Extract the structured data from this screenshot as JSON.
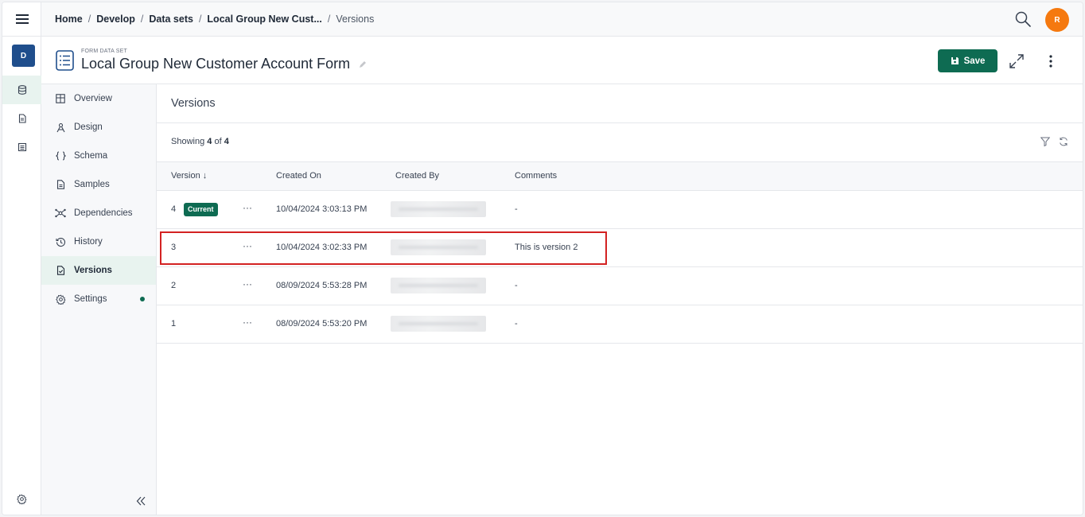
{
  "rail": {
    "workspace_letter": "D"
  },
  "breadcrumbs": [
    "Home",
    "Develop",
    "Data sets",
    "Local Group New Cust..."
  ],
  "breadcrumb_current": "Versions",
  "user": {
    "avatar_letter": "R",
    "avatar_color": "#f5790f"
  },
  "header": {
    "subtitle": "FORM DATA SET",
    "title": "Local Group New Customer Account Form",
    "save_label": "Save"
  },
  "sidenav": {
    "items": [
      {
        "label": "Overview",
        "icon": "table-icon"
      },
      {
        "label": "Design",
        "icon": "design-icon"
      },
      {
        "label": "Schema",
        "icon": "braces-icon"
      },
      {
        "label": "Samples",
        "icon": "file-icon"
      },
      {
        "label": "Dependencies",
        "icon": "network-icon"
      },
      {
        "label": "History",
        "icon": "history-icon"
      },
      {
        "label": "Versions",
        "icon": "versions-icon",
        "active": true
      },
      {
        "label": "Settings",
        "icon": "gear-icon",
        "dot": true
      }
    ]
  },
  "content": {
    "title": "Versions",
    "showing_prefix": "Showing",
    "showing_count": "4",
    "showing_of": "of",
    "showing_total": "4"
  },
  "table": {
    "columns": [
      "Version ↓",
      "Created On",
      "Created By",
      "Comments"
    ],
    "rows": [
      {
        "version": "4",
        "badge": "Current",
        "created_on": "10/04/2024 3:03:13 PM",
        "comments": "-"
      },
      {
        "version": "3",
        "badge": "",
        "created_on": "10/04/2024 3:02:33 PM",
        "comments": "This is version 2"
      },
      {
        "version": "2",
        "badge": "",
        "created_on": "08/09/2024 5:53:28 PM",
        "comments": "-"
      },
      {
        "version": "1",
        "badge": "",
        "created_on": "08/09/2024 5:53:20 PM",
        "comments": "-"
      }
    ]
  },
  "colors": {
    "accent": "#0e6b52",
    "workspace": "#1f4e8c",
    "highlight": "#d32222"
  }
}
